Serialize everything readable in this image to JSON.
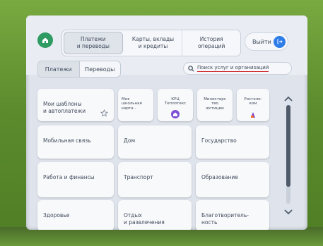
{
  "nav": {
    "tabs": [
      {
        "label": "Платежи\nи переводы",
        "active": true
      },
      {
        "label": "Карты, вклады\nи кредиты",
        "active": false
      },
      {
        "label": "История\nопераций",
        "active": false
      }
    ],
    "exit_label": "Выйти"
  },
  "subtabs": [
    {
      "label": "Платежи",
      "active": true
    },
    {
      "label": "Переводы",
      "active": false
    }
  ],
  "search": {
    "placeholder": "Поиск услуг и организаций"
  },
  "tiles": {
    "templates": "Мои шаблоны\nи автоплатежи",
    "school_card": "Моя\nшкольная\nкарта -",
    "krc": "КРЦ\nТеплотекс",
    "ministry": "Министерс\nтво\nюстиции",
    "rostelecom": "Ростеле-\nком",
    "mobile": "Мобильная связь",
    "home": "Дом",
    "state": "Государство",
    "work_finance": "Работа и финансы",
    "transport": "Транспорт",
    "education": "Образование",
    "health": "Здоровье",
    "leisure": "Отдых\nи развлечения",
    "charity": "Благотворитель-\nность"
  },
  "scroll": {
    "position": 0.3
  },
  "colors": {
    "accent_green": "#2f9b63",
    "accent_blue": "#2e7de9",
    "search_underline": "#d12b2b",
    "rostelecom_purple": "#7b3fd1"
  }
}
